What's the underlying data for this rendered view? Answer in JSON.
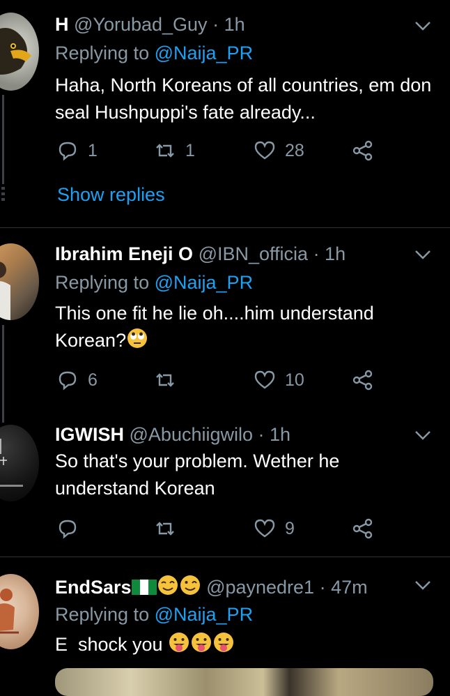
{
  "colors": {
    "background": "#000000",
    "text": "#ffffff",
    "muted": "#8899a6",
    "accent": "#1da1f2",
    "divider": "#2f3336"
  },
  "tweets": [
    {
      "name": "H",
      "handle": "@Yorubad_Guy",
      "time": "· 1h",
      "replying_prefix": "Replying to",
      "replying_to": "@Naija_PR",
      "text": "Haha, North Koreans of all countries, em don seal Hushpuppi's fate already...",
      "reply_count": "1",
      "retweet_count": "1",
      "like_count": "28",
      "show_replies": "Show replies"
    },
    {
      "name": "Ibrahim Eneji O",
      "handle": "@IBN_officia",
      "time": "· 1h",
      "replying_prefix": "Replying to",
      "replying_to": "@Naija_PR",
      "text": "This one fit he lie oh....him understand Korean?",
      "reply_count": "6",
      "retweet_count": "",
      "like_count": "10"
    },
    {
      "name": "IGWISH",
      "handle": "@Abuchiigwilo",
      "time": "· 1h",
      "text": "So that's your problem. Wether he understand Korean",
      "reply_count": "",
      "retweet_count": "",
      "like_count": "9"
    },
    {
      "name": "EndSars",
      "handle": "@paynedre1",
      "time": "· 47m",
      "replying_prefix": "Replying to",
      "replying_to": "@Naija_PR",
      "text": "E  shock you"
    }
  ],
  "icons": [
    "reply-icon",
    "retweet-icon",
    "like-icon",
    "share-icon",
    "chevron-down-icon",
    "nigeria-flag-icon",
    "wink-face-icon",
    "tongue-face-icon",
    "eye-roll-face-icon"
  ]
}
